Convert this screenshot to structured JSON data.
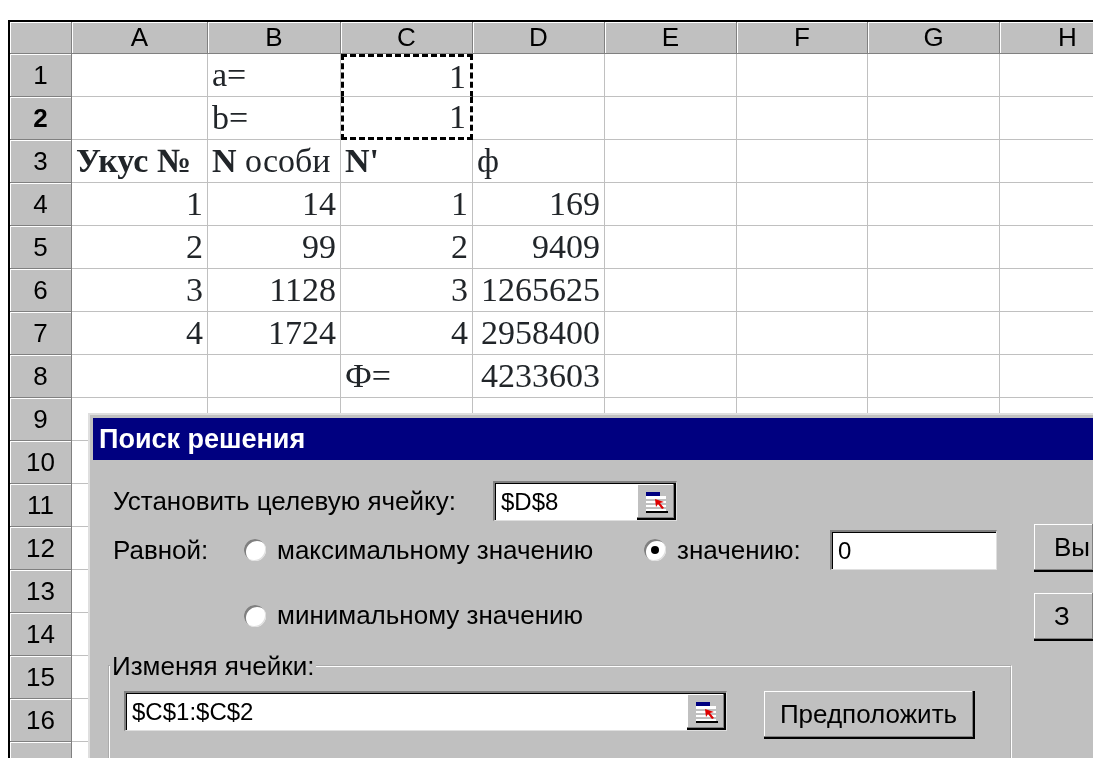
{
  "sheet": {
    "columns": [
      {
        "label": "A",
        "selected": false
      },
      {
        "label": "B",
        "selected": false
      },
      {
        "label": "C",
        "selected": false
      },
      {
        "label": "D",
        "selected": false
      },
      {
        "label": "E",
        "selected": false
      },
      {
        "label": "F",
        "selected": false
      },
      {
        "label": "G",
        "selected": false
      },
      {
        "label": "H",
        "selected": false
      }
    ],
    "rows": [
      {
        "header": "1",
        "selected": false,
        "cells": [
          {},
          {
            "text": "a=",
            "kind": "text"
          },
          {
            "text": "1",
            "kind": "number",
            "marquee": true
          },
          {},
          {},
          {},
          {},
          {}
        ]
      },
      {
        "header": "2",
        "selected": true,
        "cells": [
          {},
          {
            "text": "b=",
            "kind": "text"
          },
          {
            "text": "1",
            "kind": "number",
            "marquee": true
          },
          {},
          {},
          {},
          {},
          {}
        ]
      },
      {
        "header": "3",
        "selected": false,
        "cells": [
          {
            "text": "Укус №",
            "kind": "text",
            "bold": true
          },
          {
            "text": "**N** особи",
            "kind": "text"
          },
          {
            "text": "N'",
            "kind": "text",
            "bold": true
          },
          {
            "text": "ф",
            "kind": "text"
          },
          {},
          {},
          {},
          {}
        ]
      },
      {
        "header": "4",
        "selected": false,
        "cells": [
          {
            "text": "1",
            "kind": "number"
          },
          {
            "text": "14",
            "kind": "number"
          },
          {
            "text": "1",
            "kind": "number"
          },
          {
            "text": "169",
            "kind": "number"
          },
          {},
          {},
          {},
          {}
        ]
      },
      {
        "header": "5",
        "selected": false,
        "cells": [
          {
            "text": "2",
            "kind": "number"
          },
          {
            "text": "99",
            "kind": "number"
          },
          {
            "text": "2",
            "kind": "number"
          },
          {
            "text": "9409",
            "kind": "number"
          },
          {},
          {},
          {},
          {}
        ]
      },
      {
        "header": "6",
        "selected": false,
        "cells": [
          {
            "text": "3",
            "kind": "number"
          },
          {
            "text": "1128",
            "kind": "number"
          },
          {
            "text": "3",
            "kind": "number"
          },
          {
            "text": "1265625",
            "kind": "number"
          },
          {},
          {},
          {},
          {}
        ]
      },
      {
        "header": "7",
        "selected": false,
        "cells": [
          {
            "text": "4",
            "kind": "number"
          },
          {
            "text": "1724",
            "kind": "number"
          },
          {
            "text": "4",
            "kind": "number"
          },
          {
            "text": "2958400",
            "kind": "number"
          },
          {},
          {},
          {},
          {}
        ]
      },
      {
        "header": "8",
        "selected": false,
        "cells": [
          {},
          {},
          {
            "text": "Ф=",
            "kind": "text"
          },
          {
            "text": "4233603",
            "kind": "number"
          },
          {},
          {},
          {},
          {}
        ]
      },
      {
        "header": "9",
        "selected": false
      },
      {
        "header": "10",
        "selected": false
      },
      {
        "header": "11",
        "selected": false
      },
      {
        "header": "12",
        "selected": false
      },
      {
        "header": "13",
        "selected": false
      },
      {
        "header": "14",
        "selected": false
      },
      {
        "header": "15",
        "selected": false
      },
      {
        "header": "16",
        "selected": false
      }
    ]
  },
  "dialog": {
    "title": "Поиск решения",
    "target": {
      "label": "Установить целевую ячейку:",
      "value": "$D$8"
    },
    "equal_label": "Равной:",
    "options": [
      {
        "label": "максимальному значению",
        "selected": false
      },
      {
        "label": "значению:",
        "selected": true
      },
      {
        "label": "минимальному значению",
        "selected": false
      }
    ],
    "value_field": {
      "value": "0"
    },
    "changing": {
      "legend": "Изменяя ячейки:",
      "value": "$C$1:$C$2",
      "guess_button": "Предположить"
    },
    "side_buttons": [
      "Вы",
      "З"
    ]
  }
}
